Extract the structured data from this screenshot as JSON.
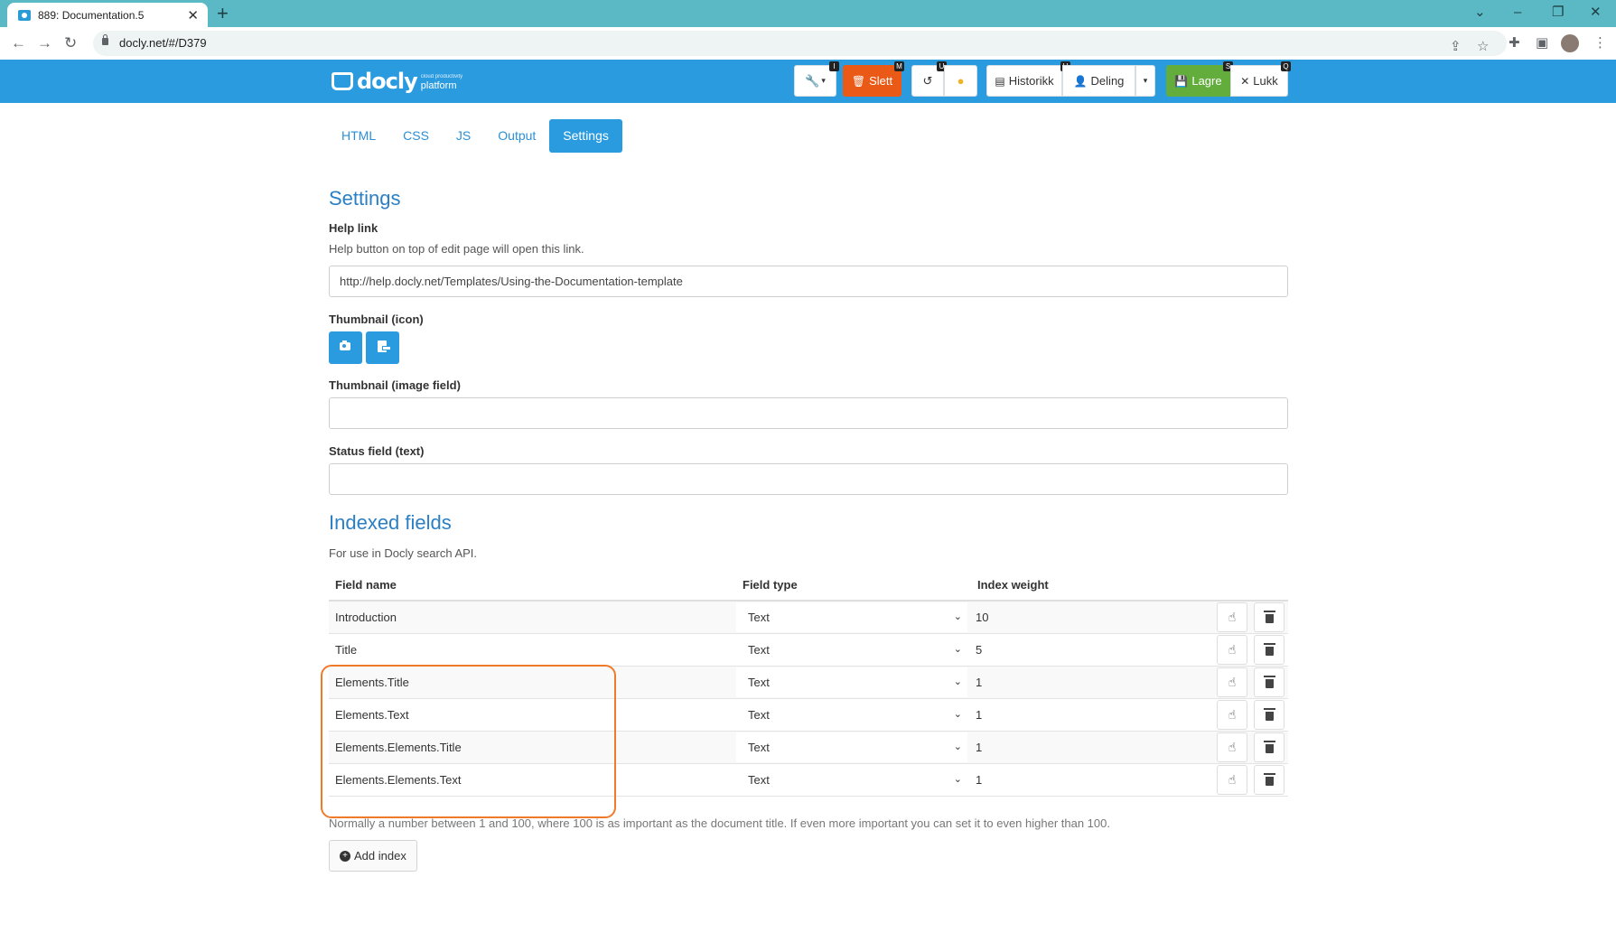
{
  "browser": {
    "tab_title": "889: Documentation.5",
    "tab_close": "✕",
    "new_tab": "+",
    "url": "docly.net/#/D379"
  },
  "app": {
    "logo_word": "docly",
    "logo_tagline": "cloud productivity",
    "logo_sub": "platform",
    "toolbar": {
      "tools_shortcut": "I",
      "delete_label": "Slett",
      "delete_shortcut": "M",
      "undo_shortcut": "U",
      "history_label": "Historikk",
      "history_shortcut": "H",
      "share_label": "Deling",
      "save_label": "Lagre",
      "save_shortcut": "S",
      "close_label": "Lukk",
      "close_shortcut": "Q"
    },
    "colors": {
      "header": "#2b9be0",
      "delete": "#ea5a16",
      "save": "#62ad3c",
      "highlight": "#f07a2a"
    }
  },
  "tabs": [
    {
      "label": "HTML"
    },
    {
      "label": "CSS"
    },
    {
      "label": "JS"
    },
    {
      "label": "Output"
    },
    {
      "label": "Settings",
      "active": true
    }
  ],
  "settings": {
    "title": "Settings",
    "help_link_label": "Help link",
    "help_link_desc": "Help button on top of edit page will open this link.",
    "help_link_value": "http://help.docly.net/Templates/Using-the-Documentation-template",
    "thumbnail_icon_label": "Thumbnail (icon)",
    "thumbnail_image_label": "Thumbnail (image field)",
    "thumbnail_image_value": "",
    "status_field_label": "Status field (text)",
    "status_field_value": ""
  },
  "indexed": {
    "title": "Indexed fields",
    "desc": "For use in Docly search API.",
    "headers": {
      "field_name": "Field name",
      "field_type": "Field type",
      "index_weight": "Index weight"
    },
    "rows": [
      {
        "name": "Introduction",
        "type": "Text",
        "weight": "10"
      },
      {
        "name": "Title",
        "type": "Text",
        "weight": "5"
      },
      {
        "name": "Elements.Title",
        "type": "Text",
        "weight": "1"
      },
      {
        "name": "Elements.Text",
        "type": "Text",
        "weight": "1"
      },
      {
        "name": "Elements.Elements.Title",
        "type": "Text",
        "weight": "1"
      },
      {
        "name": "Elements.Elements.Text",
        "type": "Text",
        "weight": "1"
      }
    ],
    "note": "Normally a number between 1 and 100, where 100 is as important as the document title. If even more important you can set it to even higher than 100.",
    "add_label": "Add index"
  }
}
